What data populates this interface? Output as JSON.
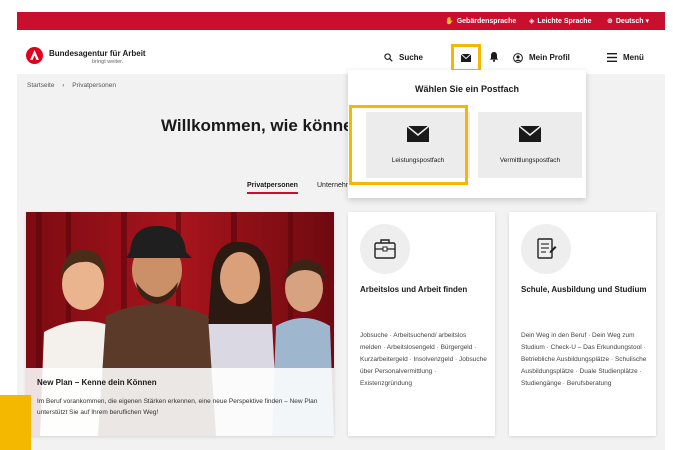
{
  "topbar": {
    "items": [
      {
        "icon": "sign-language-icon",
        "label": "Gebärdensprache"
      },
      {
        "icon": "easy-language-icon",
        "label": "Leichte Sprache"
      },
      {
        "icon": "globe-icon",
        "label": "Deutsch"
      }
    ]
  },
  "header": {
    "brand": "Bundesagentur für Arbeit",
    "tagline": "bringt weiter.",
    "search_label": "Suche",
    "profile_label": "Mein Profil",
    "menu_label": "Menü"
  },
  "breadcrumb": {
    "items": [
      "Startseite",
      "Privatpersonen"
    ]
  },
  "welcome": {
    "heading": "Willkommen, wie können"
  },
  "tabs": [
    "Privatpersonen",
    "Unternehmen"
  ],
  "mailbox_dropdown": {
    "title": "Wählen Sie ein Postfach",
    "options": [
      {
        "label": "Leistungspostfach",
        "icon": "envelope-icon"
      },
      {
        "label": "Vermittlungspostfach",
        "icon": "envelope-icon"
      }
    ]
  },
  "hero": {
    "title": "New Plan – Kenne dein Können",
    "text": "Im Beruf vorankommen, die eigenen Stärken erkennen, eine neue Perspektive finden – New Plan unterstützt Sie auf Ihrem beruflichen Weg!"
  },
  "cards": [
    {
      "title": "Arbeitslos und Arbeit finden",
      "icon": "job-folder-icon",
      "links": "Jobsuche · Arbeitsuchend/ arbeitslos melden · Arbeitslosengeld · Bürgergeld · Kurzarbeitergeld · Insolvenzgeld · Jobsuche über Personalvermittlung · Existenzgründung"
    },
    {
      "title": "Schule, Ausbildung und Studium",
      "icon": "document-icon",
      "links": "Dein Weg in den Beruf · Dein Weg zum Studium · Check-U – Das Erkundungstool · Betriebliche Ausbildungsplätze · Schulische Ausbildungsplätze · Duale Studienplätze · Studiengänge · Berufsberatung"
    }
  ],
  "colors": {
    "brand_red": "#c8102e",
    "highlight_yellow": "#f5b800"
  }
}
